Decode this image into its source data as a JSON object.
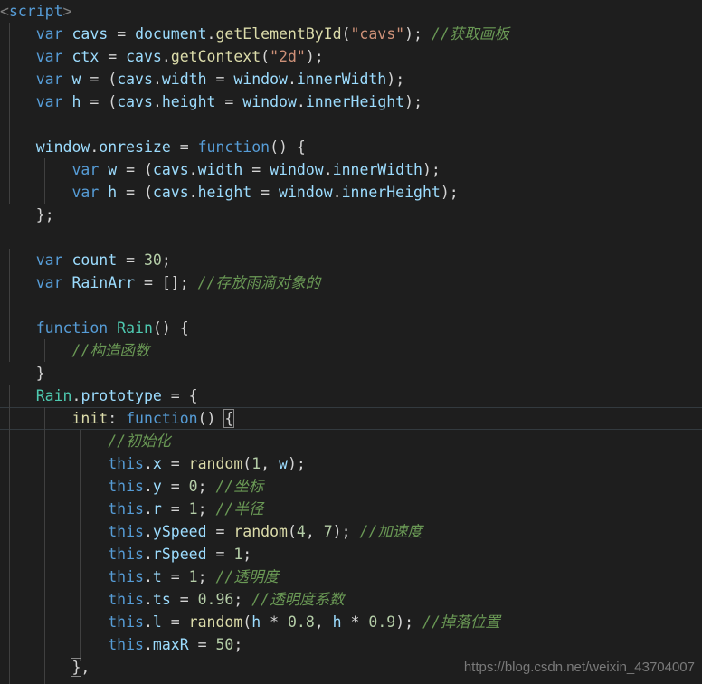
{
  "editor": {
    "theme": "dark-plus",
    "background": "#1e1e1e",
    "font_size_px": 16.5,
    "line_height_px": 25,
    "current_line_number": 19,
    "colors": {
      "background": "#1e1e1e",
      "foreground": "#d4d4d4",
      "keyword": "#569cd6",
      "variable": "#9cdcfe",
      "function": "#dcdcaa",
      "type": "#4ec9b0",
      "string": "#ce9178",
      "number": "#b5cea8",
      "comment": "#6a9955",
      "indent_guide": "#404040",
      "current_line_border": "#333a3f",
      "bracket_match_border": "#888888",
      "watermark": "#8a8a8a"
    }
  },
  "watermark": {
    "text": "https://blog.csdn.net/weixin_43704007"
  },
  "code": {
    "language": "javascript",
    "lines": [
      "<script>",
      "    var cavs = document.getElementById(\"cavs\"); //获取画板",
      "    var ctx = cavs.getContext(\"2d\");",
      "    var w = (cavs.width = window.innerWidth);",
      "    var h = (cavs.height = window.innerHeight);",
      "",
      "    window.onresize = function() {",
      "        var w = (cavs.width = window.innerWidth);",
      "        var h = (cavs.height = window.innerHeight);",
      "    };",
      "",
      "    var count = 30;",
      "    var RainArr = []; //存放雨滴对象的",
      "",
      "    function Rain() {",
      "        //构造函数",
      "    }",
      "    Rain.prototype = {",
      "        init: function() {",
      "            //初始化",
      "            this.x = random(1, w);",
      "            this.y = 0; //坐标",
      "            this.r = 1; //半径",
      "            this.ySpeed = random(4, 7); //加速度",
      "            this.rSpeed = 1;",
      "            this.t = 1; //透明度",
      "            this.ts = 0.96; //透明度系数",
      "            this.l = random(h * 0.8, h * 0.9); //掉落位置",
      "            this.maxR = 50;",
      "        },"
    ],
    "tokens": {
      "l1": {
        "open": "<",
        "name": "script",
        "close": ">"
      },
      "l2": {
        "kw": "var",
        "name": "cavs",
        "obj": "document",
        "method": "getElementById",
        "arg": "\"cavs\"",
        "comment": "//获取画板"
      },
      "l3": {
        "kw": "var",
        "name": "ctx",
        "obj": "cavs",
        "method": "getContext",
        "arg": "\"2d\""
      },
      "l4": {
        "kw": "var",
        "name": "w",
        "prop": "cavs.width",
        "value": "window.innerWidth"
      },
      "l5": {
        "kw": "var",
        "name": "h",
        "prop": "cavs.height",
        "value": "window.innerHeight"
      },
      "l7": {
        "target": "window.onresize",
        "kw": "function"
      },
      "l12": {
        "kw": "var",
        "name": "count",
        "value": "30"
      },
      "l13": {
        "kw": "var",
        "name": "RainArr",
        "value": "[]",
        "comment": "//存放雨滴对象的"
      },
      "l15": {
        "kw": "function",
        "name": "Rain"
      },
      "l16": {
        "comment": "//构造函数"
      },
      "l18": {
        "type": "Rain",
        "prop": "prototype"
      },
      "l19": {
        "key": "init",
        "kw": "function"
      },
      "l20": {
        "comment": "//初始化"
      },
      "l21": {
        "prop": "x",
        "call": "random",
        "args": "1, w"
      },
      "l22": {
        "prop": "y",
        "value": "0",
        "comment": "//坐标"
      },
      "l23": {
        "prop": "r",
        "value": "1",
        "comment": "//半径"
      },
      "l24": {
        "prop": "ySpeed",
        "call": "random",
        "args": "4, 7",
        "comment": "//加速度"
      },
      "l25": {
        "prop": "rSpeed",
        "value": "1"
      },
      "l26": {
        "prop": "t",
        "value": "1",
        "comment": "//透明度"
      },
      "l27": {
        "prop": "ts",
        "value": "0.96",
        "comment": "//透明度系数"
      },
      "l28": {
        "prop": "l",
        "call": "random",
        "args": "h * 0.8, h * 0.9",
        "comment": "//掉落位置"
      },
      "l29": {
        "prop": "maxR",
        "value": "50"
      }
    }
  }
}
